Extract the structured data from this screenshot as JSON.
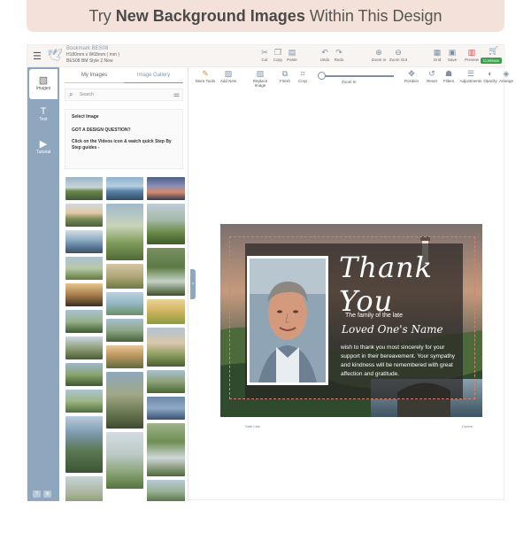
{
  "banner": {
    "prefix": "Try",
    "bold": "New Background Images",
    "suffix": "Within This Design"
  },
  "topbar": {
    "doc_name": "Bookmark BES08",
    "doc_size": "H180mm x W68mm ( mm )",
    "doc_style": "BES08 BM Style 2 New",
    "tools": [
      {
        "label": "Cut",
        "icon": "scissors-icon",
        "glyph": "✂"
      },
      {
        "label": "Copy",
        "icon": "copy-icon",
        "glyph": "❐"
      },
      {
        "label": "Paste",
        "icon": "paste-icon",
        "glyph": "▤"
      },
      {
        "label": "Undo",
        "icon": "undo-icon",
        "glyph": "↶"
      },
      {
        "label": "Redo",
        "icon": "redo-icon",
        "glyph": "↷"
      },
      {
        "label": "Zoom In",
        "icon": "zoom-in-icon",
        "glyph": "⊕"
      },
      {
        "label": "Zoom Out",
        "icon": "zoom-out-icon",
        "glyph": "⊖"
      },
      {
        "label": "Grid",
        "icon": "grid-icon",
        "glyph": "▦"
      },
      {
        "label": "Save",
        "icon": "save-icon",
        "glyph": "▣"
      },
      {
        "label": "Preview",
        "icon": "preview-icon",
        "glyph": "▥"
      }
    ],
    "continue_label": "Continue"
  },
  "rail": {
    "items": [
      {
        "label": "Images",
        "glyph": "▧"
      },
      {
        "label": "Text",
        "glyph": "T"
      },
      {
        "label": "Tutorial",
        "glyph": "▶"
      }
    ],
    "foot": [
      "?",
      "⚙"
    ]
  },
  "panel": {
    "tabs": [
      "My Images",
      "Image Gallery"
    ],
    "search_placeholder": "Search",
    "info": {
      "title": "Select Image",
      "q": "GOT A DESIGN QUESTION?",
      "body": "Click on the Videos icon & watch quick Step By Step guides -"
    }
  },
  "toolbar2": {
    "tools": [
      {
        "label": "More Tools",
        "glyph": "✎",
        "orange": true
      },
      {
        "label": "Add New",
        "glyph": "▨"
      },
      {
        "label": "Replace Image",
        "glyph": "▨"
      },
      {
        "label": "Finish",
        "glyph": "⧉"
      },
      {
        "label": "Crop",
        "glyph": "⌗"
      },
      {
        "label": "Position",
        "glyph": "✥"
      },
      {
        "label": "Reset",
        "glyph": "↺"
      },
      {
        "label": "Filters",
        "glyph": "☗"
      },
      {
        "label": "Adjustments",
        "glyph": "☰"
      },
      {
        "label": "Opacity",
        "glyph": "◐"
      },
      {
        "label": "Arrange",
        "glyph": "◈"
      }
    ],
    "zoom_label": "Zoom In"
  },
  "design": {
    "thank_you": "Thank You",
    "family": "The family of the late",
    "loved_name": "Loved One's Name",
    "message": "wish to thank you most sincerely for your support in their bereavement. Your sympathy and kindness will be remembered with great affection and gratitude.",
    "bleed_label": "Safe Line",
    "corner_label": "Centre"
  }
}
